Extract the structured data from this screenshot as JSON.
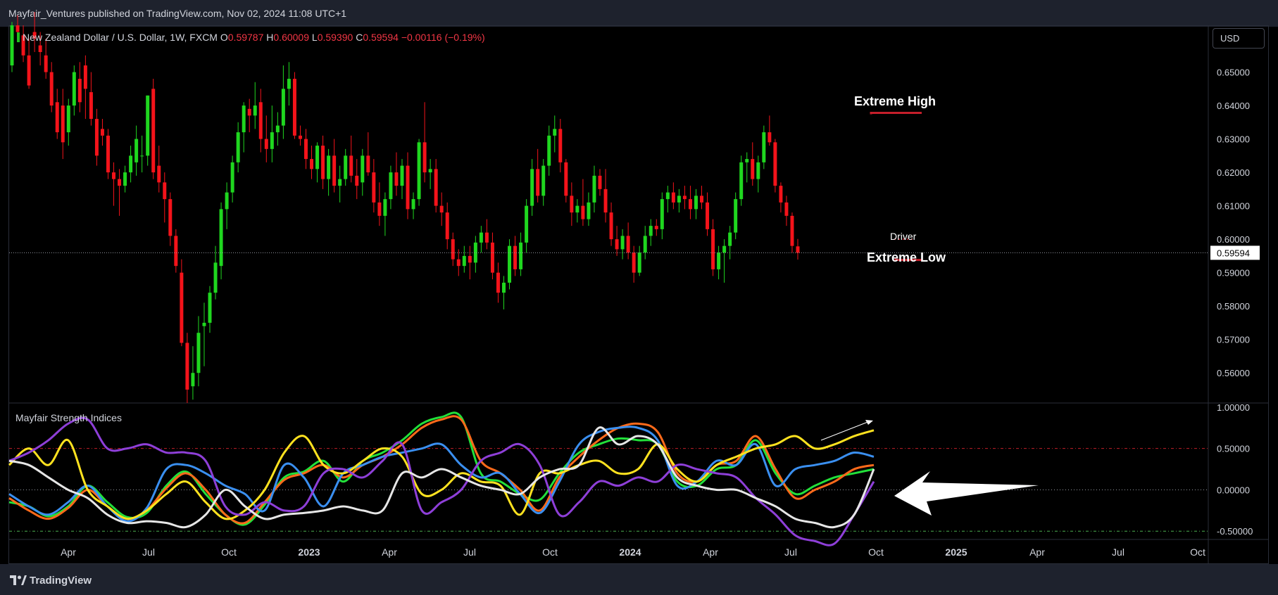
{
  "header": {
    "publisher_line": "Mayfair_Ventures published on TradingView.com, Nov 02, 2024 11:08 UTC+1"
  },
  "symbol": {
    "name": "New Zealand Dollar / U.S. Dollar, 1W, FXCM",
    "o_label": "O",
    "o_value": "0.59787",
    "h_label": "H",
    "h_value": "0.60009",
    "l_label": "L",
    "l_value": "0.59390",
    "c_label": "C",
    "c_value": "0.59594",
    "change": "−0.00116 (−0.19%)"
  },
  "currency_button": "USD",
  "last_price_label": "0.59594",
  "indicator": {
    "title": "Mayfair Strength Indices"
  },
  "annotations": {
    "extreme_high": "Extreme High",
    "extreme_low": "Extreme Low",
    "driver": "Driver"
  },
  "footer": {
    "brand": "TradingView"
  },
  "colors": {
    "up": "#1fd71f",
    "down": "#f4131a",
    "background": "#000000",
    "series_green": "#22e03a",
    "series_orange": "#ff6a1a",
    "series_blue": "#3a8ff0",
    "series_yellow": "#ffe21f",
    "series_purple": "#8e3fd8",
    "series_white": "#e6e6e6"
  },
  "chart_data": [
    {
      "type": "candlestick",
      "title": "New Zealand Dollar / U.S. Dollar, 1W, FXCM",
      "ylim": [
        0.551,
        0.664
      ],
      "y_ticks": [
        0.65,
        0.64,
        0.63,
        0.62,
        0.61,
        0.6,
        0.59,
        0.58,
        0.57,
        0.56
      ],
      "y_tick_labels": [
        "0.65000",
        "0.64000",
        "0.63000",
        "0.62000",
        "0.61000",
        "0.60000",
        "0.59000",
        "0.58000",
        "0.57000",
        "0.56000"
      ],
      "x_tick_labels": [
        "Apr",
        "Jul",
        "Oct",
        "2023",
        "Apr",
        "Jul",
        "Oct",
        "2024",
        "Apr",
        "Jul",
        "Oct",
        "2025",
        "Apr",
        "Jul",
        "Oct"
      ],
      "last_price": 0.59594,
      "ohlc_weekly": [
        [
          0.652,
          0.665,
          0.65,
          0.664
        ],
        [
          0.664,
          0.667,
          0.66,
          0.662
        ],
        [
          0.661,
          0.664,
          0.653,
          0.655
        ],
        [
          0.655,
          0.66,
          0.645,
          0.646
        ],
        [
          0.662,
          0.668,
          0.656,
          0.66
        ],
        [
          0.658,
          0.662,
          0.652,
          0.656
        ],
        [
          0.655,
          0.66,
          0.648,
          0.65
        ],
        [
          0.65,
          0.653,
          0.638,
          0.64
        ],
        [
          0.641,
          0.645,
          0.63,
          0.632
        ],
        [
          0.64,
          0.645,
          0.624,
          0.629
        ],
        [
          0.632,
          0.642,
          0.628,
          0.64
        ],
        [
          0.64,
          0.652,
          0.637,
          0.65
        ],
        [
          0.648,
          0.653,
          0.638,
          0.641
        ],
        [
          0.652,
          0.655,
          0.636,
          0.645
        ],
        [
          0.644,
          0.65,
          0.634,
          0.636
        ],
        [
          0.636,
          0.639,
          0.622,
          0.625
        ],
        [
          0.633,
          0.636,
          0.628,
          0.631
        ],
        [
          0.631,
          0.633,
          0.618,
          0.62
        ],
        [
          0.62,
          0.623,
          0.61,
          0.618
        ],
        [
          0.618,
          0.621,
          0.607,
          0.616
        ],
        [
          0.616,
          0.622,
          0.614,
          0.62
        ],
        [
          0.62,
          0.628,
          0.617,
          0.625
        ],
        [
          0.623,
          0.634,
          0.619,
          0.63
        ],
        [
          0.625,
          0.631,
          0.62,
          0.625
        ],
        [
          0.625,
          0.643,
          0.622,
          0.643
        ],
        [
          0.645,
          0.648,
          0.618,
          0.62
        ],
        [
          0.622,
          0.628,
          0.614,
          0.617
        ],
        [
          0.617,
          0.62,
          0.605,
          0.612
        ],
        [
          0.612,
          0.614,
          0.598,
          0.601
        ],
        [
          0.601,
          0.603,
          0.59,
          0.592
        ],
        [
          0.59,
          0.594,
          0.568,
          0.569
        ],
        [
          0.569,
          0.572,
          0.551,
          0.555
        ],
        [
          0.556,
          0.568,
          0.552,
          0.56
        ],
        [
          0.56,
          0.577,
          0.556,
          0.572
        ],
        [
          0.574,
          0.581,
          0.562,
          0.575
        ],
        [
          0.575,
          0.586,
          0.572,
          0.584
        ],
        [
          0.584,
          0.598,
          0.582,
          0.593
        ],
        [
          0.592,
          0.611,
          0.588,
          0.609
        ],
        [
          0.609,
          0.617,
          0.603,
          0.614
        ],
        [
          0.614,
          0.625,
          0.611,
          0.623
        ],
        [
          0.623,
          0.635,
          0.62,
          0.632
        ],
        [
          0.632,
          0.641,
          0.626,
          0.64
        ],
        [
          0.639,
          0.642,
          0.632,
          0.637
        ],
        [
          0.637,
          0.647,
          0.633,
          0.64
        ],
        [
          0.641,
          0.645,
          0.626,
          0.63
        ],
        [
          0.63,
          0.637,
          0.623,
          0.627
        ],
        [
          0.627,
          0.64,
          0.623,
          0.632
        ],
        [
          0.632,
          0.638,
          0.628,
          0.634
        ],
        [
          0.634,
          0.652,
          0.63,
          0.645
        ],
        [
          0.645,
          0.653,
          0.64,
          0.648
        ],
        [
          0.648,
          0.65,
          0.63,
          0.631
        ],
        [
          0.631,
          0.634,
          0.628,
          0.63
        ],
        [
          0.63,
          0.633,
          0.621,
          0.624
        ],
        [
          0.624,
          0.628,
          0.618,
          0.621
        ],
        [
          0.621,
          0.629,
          0.617,
          0.628
        ],
        [
          0.628,
          0.631,
          0.615,
          0.618
        ],
        [
          0.618,
          0.627,
          0.613,
          0.625
        ],
        [
          0.625,
          0.63,
          0.614,
          0.616
        ],
        [
          0.616,
          0.622,
          0.611,
          0.618
        ],
        [
          0.618,
          0.627,
          0.616,
          0.625
        ],
        [
          0.625,
          0.631,
          0.617,
          0.619
        ],
        [
          0.619,
          0.624,
          0.612,
          0.616
        ],
        [
          0.617,
          0.627,
          0.613,
          0.625
        ],
        [
          0.625,
          0.632,
          0.619,
          0.62
        ],
        [
          0.62,
          0.624,
          0.608,
          0.611
        ],
        [
          0.611,
          0.617,
          0.604,
          0.607
        ],
        [
          0.607,
          0.614,
          0.601,
          0.612
        ],
        [
          0.612,
          0.622,
          0.609,
          0.62
        ],
        [
          0.62,
          0.626,
          0.613,
          0.616
        ],
        [
          0.616,
          0.624,
          0.612,
          0.622
        ],
        [
          0.622,
          0.626,
          0.606,
          0.609
        ],
        [
          0.609,
          0.614,
          0.606,
          0.612
        ],
        [
          0.612,
          0.63,
          0.61,
          0.629
        ],
        [
          0.629,
          0.641,
          0.617,
          0.62
        ],
        [
          0.62,
          0.624,
          0.615,
          0.621
        ],
        [
          0.621,
          0.624,
          0.608,
          0.61
        ],
        [
          0.61,
          0.614,
          0.604,
          0.608
        ],
        [
          0.608,
          0.611,
          0.597,
          0.6
        ],
        [
          0.6,
          0.602,
          0.592,
          0.594
        ],
        [
          0.594,
          0.597,
          0.589,
          0.592
        ],
        [
          0.592,
          0.598,
          0.59,
          0.595
        ],
        [
          0.595,
          0.598,
          0.588,
          0.593
        ],
        [
          0.593,
          0.601,
          0.59,
          0.599
        ],
        [
          0.599,
          0.604,
          0.596,
          0.602
        ],
        [
          0.602,
          0.606,
          0.597,
          0.599
        ],
        [
          0.599,
          0.602,
          0.588,
          0.59
        ],
        [
          0.59,
          0.593,
          0.581,
          0.584
        ],
        [
          0.584,
          0.589,
          0.579,
          0.587
        ],
        [
          0.587,
          0.6,
          0.585,
          0.598
        ],
        [
          0.598,
          0.601,
          0.589,
          0.591
        ],
        [
          0.591,
          0.602,
          0.589,
          0.599
        ],
        [
          0.599,
          0.612,
          0.596,
          0.61
        ],
        [
          0.61,
          0.624,
          0.607,
          0.621
        ],
        [
          0.621,
          0.627,
          0.611,
          0.613
        ],
        [
          0.613,
          0.624,
          0.61,
          0.622
        ],
        [
          0.622,
          0.634,
          0.619,
          0.631
        ],
        [
          0.631,
          0.637,
          0.626,
          0.633
        ],
        [
          0.633,
          0.636,
          0.62,
          0.623
        ],
        [
          0.623,
          0.624,
          0.611,
          0.613
        ],
        [
          0.613,
          0.617,
          0.604,
          0.608
        ],
        [
          0.608,
          0.612,
          0.605,
          0.61
        ],
        [
          0.61,
          0.618,
          0.604,
          0.606
        ],
        [
          0.606,
          0.614,
          0.604,
          0.611
        ],
        [
          0.611,
          0.622,
          0.608,
          0.619
        ],
        [
          0.619,
          0.621,
          0.613,
          0.615
        ],
        [
          0.615,
          0.621,
          0.605,
          0.608
        ],
        [
          0.608,
          0.611,
          0.598,
          0.6
        ],
        [
          0.6,
          0.604,
          0.595,
          0.597
        ],
        [
          0.597,
          0.603,
          0.594,
          0.601
        ],
        [
          0.601,
          0.605,
          0.594,
          0.596
        ],
        [
          0.596,
          0.598,
          0.587,
          0.59
        ],
        [
          0.59,
          0.598,
          0.589,
          0.596
        ],
        [
          0.596,
          0.604,
          0.594,
          0.601
        ],
        [
          0.601,
          0.606,
          0.598,
          0.604
        ],
        [
          0.604,
          0.606,
          0.601,
          0.603
        ],
        [
          0.603,
          0.614,
          0.6,
          0.612
        ],
        [
          0.612,
          0.616,
          0.608,
          0.614
        ],
        [
          0.614,
          0.617,
          0.609,
          0.611
        ],
        [
          0.611,
          0.615,
          0.608,
          0.613
        ],
        [
          0.613,
          0.616,
          0.609,
          0.612
        ],
        [
          0.612,
          0.616,
          0.606,
          0.609
        ],
        [
          0.609,
          0.615,
          0.606,
          0.613
        ],
        [
          0.613,
          0.616,
          0.609,
          0.611
        ],
        [
          0.611,
          0.614,
          0.601,
          0.603
        ],
        [
          0.603,
          0.606,
          0.589,
          0.591
        ],
        [
          0.591,
          0.598,
          0.588,
          0.596
        ],
        [
          0.596,
          0.6,
          0.587,
          0.598
        ],
        [
          0.598,
          0.604,
          0.594,
          0.602
        ],
        [
          0.602,
          0.614,
          0.6,
          0.612
        ],
        [
          0.612,
          0.625,
          0.61,
          0.623
        ],
        [
          0.623,
          0.626,
          0.617,
          0.624
        ],
        [
          0.624,
          0.629,
          0.616,
          0.618
        ],
        [
          0.618,
          0.625,
          0.614,
          0.623
        ],
        [
          0.623,
          0.634,
          0.621,
          0.632
        ],
        [
          0.632,
          0.637,
          0.628,
          0.629
        ],
        [
          0.629,
          0.63,
          0.614,
          0.616
        ],
        [
          0.616,
          0.617,
          0.608,
          0.611
        ],
        [
          0.611,
          0.613,
          0.604,
          0.607
        ],
        [
          0.607,
          0.608,
          0.596,
          0.598
        ],
        [
          0.59787,
          0.60009,
          0.5939,
          0.59594
        ]
      ]
    },
    {
      "type": "line",
      "title": "Mayfair Strength Indices",
      "ylim": [
        -0.6,
        1.05
      ],
      "y_ticks": [
        1.0,
        0.5,
        0.0,
        -0.5
      ],
      "y_tick_labels": [
        "1.00000",
        "0.50000",
        "0.00000",
        "-0.50000"
      ],
      "reference_lines": [
        0.5,
        0.0,
        -0.5
      ],
      "series": [
        {
          "color": "#22e03a",
          "values": [
            -0.15,
            -0.2,
            -0.32,
            -0.2,
            0.05,
            -0.15,
            -0.33,
            -0.28,
            0.05,
            0.22,
            -0.05,
            -0.3,
            -0.42,
            -0.18,
            0.15,
            0.22,
            0.35,
            0.1,
            0.35,
            0.45,
            0.6,
            0.8,
            0.88,
            0.88,
            0.2,
            0.1,
            -0.05,
            -0.12,
            0.2,
            0.45,
            0.55,
            0.62,
            0.6,
            0.55,
            0.1,
            0.05,
            0.25,
            0.3,
            0.6,
            0.2,
            -0.05,
            0.05,
            0.15,
            0.2,
            0.25
          ]
        },
        {
          "color": "#ff6a1a",
          "values": [
            -0.1,
            -0.25,
            -0.35,
            -0.22,
            0.0,
            -0.2,
            -0.35,
            -0.25,
            0.02,
            0.2,
            0.0,
            -0.3,
            -0.4,
            -0.15,
            0.12,
            0.2,
            0.3,
            0.15,
            0.3,
            0.4,
            0.55,
            0.75,
            0.85,
            0.85,
            0.35,
            0.2,
            0.0,
            -0.25,
            0.15,
            0.4,
            0.6,
            0.75,
            0.8,
            0.7,
            0.2,
            0.1,
            0.3,
            0.35,
            0.65,
            0.25,
            -0.1,
            0.0,
            0.1,
            0.25,
            0.3
          ]
        },
        {
          "color": "#3a8ff0",
          "values": [
            -0.05,
            -0.2,
            -0.3,
            -0.15,
            0.05,
            -0.2,
            -0.38,
            -0.22,
            0.25,
            0.3,
            0.2,
            0.05,
            -0.05,
            -0.25,
            0.3,
            0.15,
            -0.2,
            0.2,
            0.3,
            0.4,
            0.45,
            0.5,
            0.55,
            0.3,
            0.15,
            0.2,
            -0.05,
            -0.28,
            0.1,
            0.55,
            0.7,
            0.75,
            0.75,
            0.6,
            0.05,
            0.1,
            0.35,
            0.3,
            0.55,
            0.05,
            0.25,
            0.3,
            0.35,
            0.45,
            0.4
          ]
        },
        {
          "color": "#ffe21f",
          "values": [
            0.3,
            0.5,
            0.3,
            0.6,
            0.0,
            -0.2,
            -0.35,
            -0.25,
            -0.05,
            0.1,
            -0.15,
            -0.35,
            -0.25,
            0.0,
            0.45,
            0.65,
            0.3,
            0.2,
            0.35,
            0.5,
            0.4,
            -0.05,
            0.0,
            0.2,
            0.1,
            0.05,
            -0.3,
            0.2,
            0.2,
            0.3,
            0.35,
            0.2,
            0.25,
            0.55,
            0.25,
            0.1,
            0.3,
            0.4,
            0.5,
            0.55,
            0.65,
            0.5,
            0.55,
            0.65,
            0.72
          ]
        },
        {
          "color": "#8e3fd8",
          "values": [
            0.35,
            0.45,
            0.6,
            0.8,
            0.85,
            0.5,
            0.5,
            0.55,
            0.45,
            0.45,
            0.35,
            -0.2,
            -0.3,
            -0.15,
            -0.25,
            -0.2,
            0.2,
            0.25,
            0.15,
            0.35,
            0.55,
            -0.25,
            -0.15,
            0.0,
            0.35,
            0.45,
            0.55,
            0.3,
            -0.3,
            -0.15,
            0.1,
            0.05,
            0.15,
            0.1,
            0.3,
            0.25,
            0.2,
            0.15,
            -0.1,
            -0.3,
            -0.55,
            -0.62,
            -0.65,
            -0.3,
            0.1
          ]
        },
        {
          "color": "#e6e6e6",
          "values": [
            0.35,
            0.3,
            0.15,
            0.0,
            -0.1,
            -0.3,
            -0.4,
            -0.38,
            -0.4,
            -0.45,
            -0.3,
            0.0,
            -0.2,
            -0.35,
            -0.3,
            -0.28,
            -0.25,
            -0.2,
            -0.25,
            -0.25,
            0.2,
            0.15,
            0.25,
            0.15,
            0.05,
            0.0,
            -0.05,
            0.15,
            0.25,
            0.3,
            0.75,
            0.55,
            0.65,
            0.55,
            0.15,
            0.05,
            0.0,
            0.0,
            -0.1,
            -0.2,
            -0.35,
            -0.4,
            -0.45,
            -0.3,
            0.25
          ]
        }
      ]
    }
  ]
}
